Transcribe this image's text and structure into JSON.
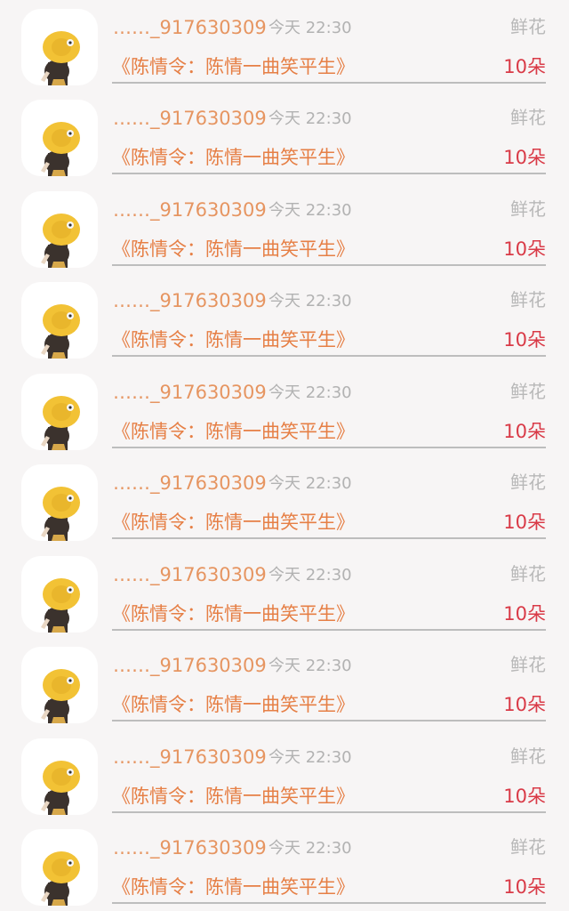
{
  "gift_list": {
    "items": [
      {
        "username": "……_917630309",
        "time": "今天 22:30",
        "gift_type": "鲜花",
        "work_title": "《陈情令：陈情一曲笑平生》",
        "amount": "10朵",
        "avatar_icon": "girl-yellow-hat-avatar-icon"
      },
      {
        "username": "……_917630309",
        "time": "今天 22:30",
        "gift_type": "鲜花",
        "work_title": "《陈情令：陈情一曲笑平生》",
        "amount": "10朵",
        "avatar_icon": "girl-yellow-hat-avatar-icon"
      },
      {
        "username": "……_917630309",
        "time": "今天 22:30",
        "gift_type": "鲜花",
        "work_title": "《陈情令：陈情一曲笑平生》",
        "amount": "10朵",
        "avatar_icon": "girl-yellow-hat-avatar-icon"
      },
      {
        "username": "……_917630309",
        "time": "今天 22:30",
        "gift_type": "鲜花",
        "work_title": "《陈情令：陈情一曲笑平生》",
        "amount": "10朵",
        "avatar_icon": "girl-yellow-hat-avatar-icon"
      },
      {
        "username": "……_917630309",
        "time": "今天 22:30",
        "gift_type": "鲜花",
        "work_title": "《陈情令：陈情一曲笑平生》",
        "amount": "10朵",
        "avatar_icon": "girl-yellow-hat-avatar-icon"
      },
      {
        "username": "……_917630309",
        "time": "今天 22:30",
        "gift_type": "鲜花",
        "work_title": "《陈情令：陈情一曲笑平生》",
        "amount": "10朵",
        "avatar_icon": "girl-yellow-hat-avatar-icon"
      },
      {
        "username": "……_917630309",
        "time": "今天 22:30",
        "gift_type": "鲜花",
        "work_title": "《陈情令：陈情一曲笑平生》",
        "amount": "10朵",
        "avatar_icon": "girl-yellow-hat-avatar-icon"
      },
      {
        "username": "……_917630309",
        "time": "今天 22:30",
        "gift_type": "鲜花",
        "work_title": "《陈情令：陈情一曲笑平生》",
        "amount": "10朵",
        "avatar_icon": "girl-yellow-hat-avatar-icon"
      },
      {
        "username": "……_917630309",
        "time": "今天 22:30",
        "gift_type": "鲜花",
        "work_title": "《陈情令：陈情一曲笑平生》",
        "amount": "10朵",
        "avatar_icon": "girl-yellow-hat-avatar-icon"
      },
      {
        "username": "……_917630309",
        "time": "今天 22:30",
        "gift_type": "鲜花",
        "work_title": "《陈情令：陈情一曲笑平生》",
        "amount": "10朵",
        "avatar_icon": "girl-yellow-hat-avatar-icon"
      }
    ]
  },
  "colors": {
    "background": "#f7f5f5",
    "username": "#e69561",
    "time": "#b2b2b2",
    "gift_type": "#b8b8b8",
    "work_title": "#e67f45",
    "amount": "#d93a47",
    "divider": "#bdbdbd"
  }
}
